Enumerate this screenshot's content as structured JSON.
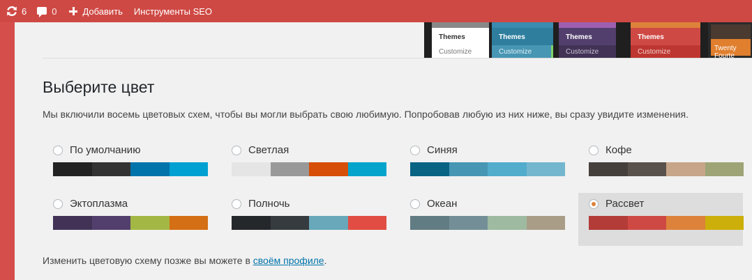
{
  "admin_bar": {
    "updates_count": "6",
    "comments_count": "0",
    "new_label": "Добавить",
    "seo_label": "Инструменты SEO",
    "icons": {
      "updates": "refresh-icon",
      "comments": "comment-bubble-icon",
      "new": "plus-icon"
    }
  },
  "previews": {
    "menu_item": "Themes",
    "sub_item": "Customize",
    "theme_name": "Twenty Fourte"
  },
  "main": {
    "title": "Выберите цвет",
    "description": "Мы включили восемь цветовых схем, чтобы вы могли выбрать свою любимую. Попробовав любую из них ниже, вы сразу увидите изменения.",
    "footer_text": "Изменить цветовую схему позже вы можете в ",
    "footer_link": "своём профиле",
    "footer_end": "."
  },
  "schemes": [
    {
      "label": "По умолчанию",
      "selected": false,
      "colors": [
        "#222222",
        "#333333",
        "#0073aa",
        "#00a0d2"
      ]
    },
    {
      "label": "Светлая",
      "selected": false,
      "colors": [
        "#e5e5e5",
        "#999999",
        "#d64e07",
        "#04a4cc"
      ]
    },
    {
      "label": "Синяя",
      "selected": false,
      "colors": [
        "#096484",
        "#4796b3",
        "#52accc",
        "#74b6ce"
      ]
    },
    {
      "label": "Кофе",
      "selected": false,
      "colors": [
        "#46403c",
        "#59524c",
        "#c7a589",
        "#9ea476"
      ]
    },
    {
      "label": "Эктоплазма",
      "selected": false,
      "colors": [
        "#413256",
        "#523f6d",
        "#a3b745",
        "#d46f15"
      ]
    },
    {
      "label": "Полночь",
      "selected": false,
      "colors": [
        "#25282b",
        "#363b3f",
        "#69a8bb",
        "#e14d43"
      ]
    },
    {
      "label": "Океан",
      "selected": false,
      "colors": [
        "#627c83",
        "#738e96",
        "#9ebaa0",
        "#aa9d88"
      ]
    },
    {
      "label": "Рассвет",
      "selected": true,
      "colors": [
        "#b43c38",
        "#cf4944",
        "#dd823b",
        "#ccaf0b"
      ]
    }
  ],
  "colors": {
    "admin_bar_bg": "#cf4944",
    "link": "#0073aa",
    "radio_checked": "#dd823b"
  }
}
